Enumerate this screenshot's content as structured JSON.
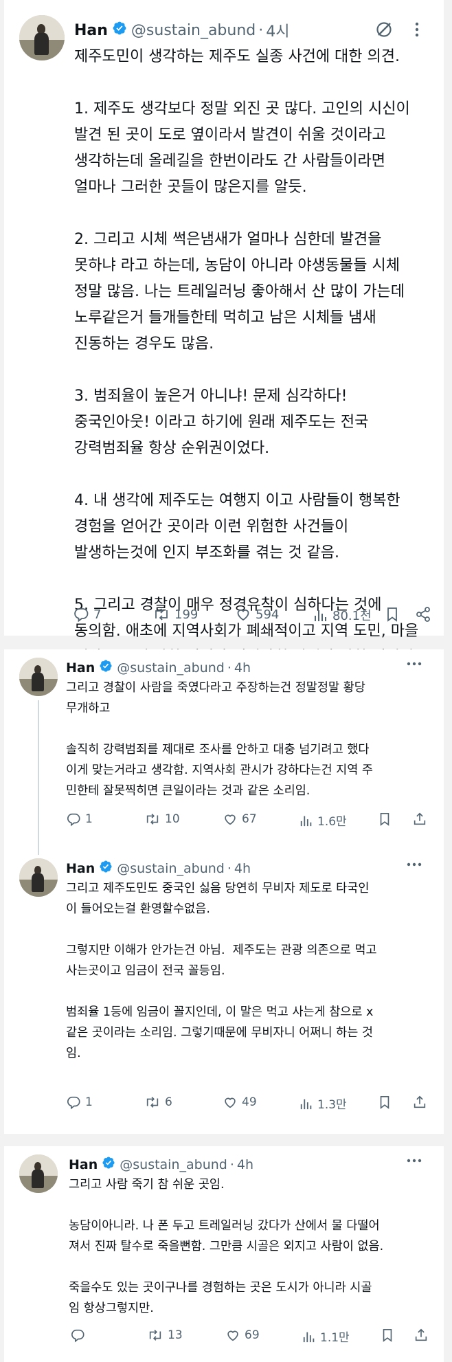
{
  "tweets": [
    {
      "name": "Han",
      "handle": "@sustain_abund",
      "time": "4시",
      "text": "제주도민이 생각하는 제주도 실종 사건에 대한 의견.\n\n1. 제주도 생각보다 정말 외진 곳 많다. 고인의 시신이\n발견 된 곳이 도로 옆이라서 발견이 쉬울 것이라고\n생각하는데 올레길을 한번이라도 간 사람들이라면\n얼마나 그러한 곳들이 많은지를 알듯.\n\n2. 그리고 시체 썩은냄새가 얼마나 심한데 발견을\n못하냐 라고 하는데, 농담이 아니라 야생동물들 시체\n정말 많음. 나는 트레일러닝 좋아해서 산 많이 가는데\n노루같은거 들개들한테 먹히고 남은 시체들 냄새\n진동하는 경우도 많음.\n\n3. 범죄율이 높은거 아니냐! 문제 심각하다!\n중국인아웃! 이라고 하기에 원래 제주도는 전국\n강력범죄율 항상 순위권이었다.\n\n4. 내 생각에 제주도는 여행지 이고 사람들이 행복한\n경험을 얻어간 곳이라 이런 위험한 사건들이\n발생하는것에 인지 부조화를 겪는 것 같음.\n\n5. 그리고 경찰이 매우 정경유착이 심하다는 것에\n동의함. 애초에 지역사회가 폐쇄적이고 지역 도민, 마을\n계장 등등에 강한 권력과 지역사회 관시가 강한 지역임.",
      "replies": "7",
      "retweets": "199",
      "likes": "594",
      "views": "80.1천"
    },
    {
      "name": "Han",
      "handle": "@sustain_abund",
      "time": "4h",
      "text": "그리고 경찰이 사람을 죽였다라고 주장하는건 정말정말 황당\n무개하고\n\n솔직히 강력범죄를 제대로 조사를 안하고 대충 넘기려고 했다\n이게 맞는거라고 생각함. 지역사회 관시가 강하다는건 지역 주\n민한테 잘못찍히면 큰일이라는 것과 같은 소리임.",
      "replies": "1",
      "retweets": "10",
      "likes": "67",
      "views": "1.6만"
    },
    {
      "name": "Han",
      "handle": "@sustain_abund",
      "time": "4h",
      "text": "그리고 제주도민도 중국인 싫음 당연히 무비자 제도로 타국인\n이 들어오는걸 환영할수없음.\n\n그렇지만 이해가 안가는건 아님.  제주도는 관광 의존으로 먹고\n사는곳이고 임금이 전국 꼴등임.\n\n범죄율 1등에 임금이 꼴지인데, 이 말은 먹고 사는게 참으로 x\n같은 곳이라는 소리임. 그렇기때문에 무비자니 어쩌니 하는 것\n임.",
      "replies": "1",
      "retweets": "6",
      "likes": "49",
      "views": "1.3만"
    },
    {
      "name": "Han",
      "handle": "@sustain_abund",
      "time": "4h",
      "text": "그리고 사람 죽기 참 쉬운 곳임.\n\n농담이아니라. 나 폰 두고 트레일러닝 갔다가 산에서 물 다떨어\n져서 진짜 탈수로 죽을뻔함. 그만큼 시골은 외지고 사람이 없음.\n\n죽을수도 있는 곳이구나를 경험하는 곳은 도시가 아니라 시골\n임 항상그렇지만.",
      "replies": "",
      "retweets": "13",
      "likes": "69",
      "views": "1.1만"
    }
  ],
  "colors": {
    "verified": "#1d9bf0",
    "muted": "#536471",
    "thread_line": "#cfd9de"
  },
  "icons": [
    "verified-badge-icon",
    "grok-icon",
    "more-icon",
    "reply-icon",
    "retweet-icon",
    "like-icon",
    "views-icon",
    "bookmark-icon",
    "share-icon"
  ]
}
